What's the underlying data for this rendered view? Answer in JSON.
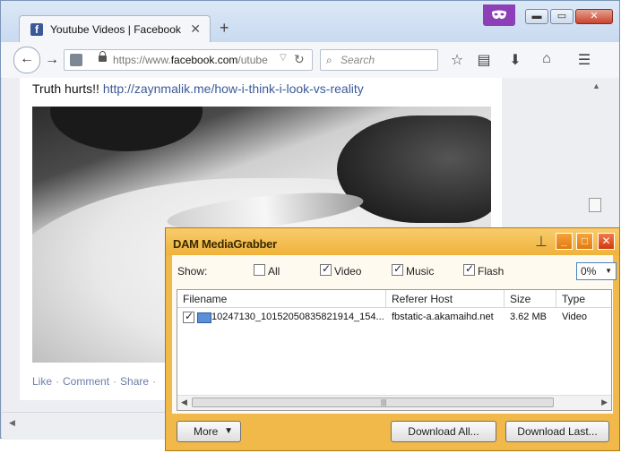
{
  "browser": {
    "tab_title": "Youtube Videos | Facebook",
    "tab_close": "✕",
    "new_tab": "+",
    "url_prefix": "https://www.",
    "url_host": "facebook.com",
    "url_path": "/utube",
    "search_placeholder": "Search",
    "icons": [
      "back-icon",
      "forward-icon",
      "page-icon",
      "lock-icon",
      "reload-icon",
      "search-icon",
      "bookmark-star-icon",
      "reading-list-icon",
      "download-icon",
      "home-icon",
      "menu-icon",
      "private-mask-icon"
    ]
  },
  "post": {
    "text": "Truth hurts!! ",
    "link": "http://zaynmalik.me/how-i-think-i-look-vs-reality",
    "actions": [
      "Like",
      "Comment",
      "Share"
    ]
  },
  "grabber": {
    "title": "DAM MediaGrabber",
    "show_label": "Show:",
    "filters": [
      {
        "label": "All",
        "checked": false
      },
      {
        "label": "Video",
        "checked": true
      },
      {
        "label": "Music",
        "checked": true
      },
      {
        "label": "Flash",
        "checked": true
      }
    ],
    "percent": "0%",
    "columns": [
      "Filename",
      "Referer Host",
      "Size",
      "Type"
    ],
    "rows": [
      {
        "checked": true,
        "filename": "10247130_10152050835821914_154...",
        "host": "fbstatic-a.akamaihd.net",
        "size": "3.62 MB",
        "type": "Video"
      }
    ],
    "more_label": "More",
    "download_all": "Download All...",
    "download_last": "Download Last..."
  },
  "colors": {
    "facebook_blue": "#3b5998",
    "grabber_orange": "#f0b94a",
    "private_purple": "#8d3fb8"
  }
}
